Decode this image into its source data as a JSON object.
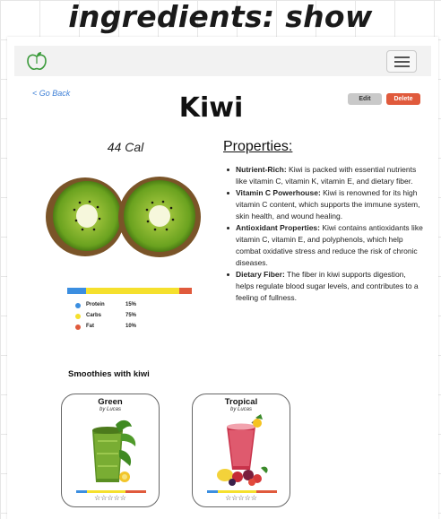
{
  "banner": {
    "text": "ingredients: show"
  },
  "navbar": {
    "logo_icon": "apple-logo-icon",
    "menu_icon": "hamburger-menu-icon"
  },
  "back_link": "< Go Back",
  "ingredient": {
    "name": "Kiwi",
    "calories": "44 Cal",
    "image_icon": "kiwi-halves-image"
  },
  "actions": {
    "edit": "Edit",
    "delete": "Delete"
  },
  "macros": [
    {
      "name": "Protein",
      "percent": "15%",
      "value": 15,
      "color": "#3b8ee0"
    },
    {
      "name": "Carbs",
      "percent": "75%",
      "value": 75,
      "color": "#f5e02d"
    },
    {
      "name": "Fat",
      "percent": "10%",
      "value": 10,
      "color": "#e05a3c"
    }
  ],
  "properties": {
    "title": "Properties:",
    "items": [
      {
        "label": "Nutrient-Rich:",
        "text": " Kiwi is packed with essential nutrients like vitamin C, vitamin K, vitamin E, and dietary fiber."
      },
      {
        "label": "Vitamin C Powerhouse:",
        "text": " Kiwi is renowned for its high vitamin C content, which supports the immune system, skin health, and wound healing."
      },
      {
        "label": "Antioxidant Properties:",
        "text": " Kiwi contains antioxidants like vitamin C, vitamin E, and polyphenols, which help combat oxidative stress and reduce the risk of chronic diseases."
      },
      {
        "label": "Dietary Fiber:",
        "text": " The fiber in kiwi supports digestion, helps regulate blood sugar levels, and contributes to a feeling of fullness."
      }
    ]
  },
  "smoothies": {
    "title": "Smoothies with kiwi",
    "items": [
      {
        "name": "Green",
        "by": "by Lucas",
        "stars": "☆☆☆☆☆",
        "rating": 0,
        "image_icon": "green-smoothie-image"
      },
      {
        "name": "Tropical",
        "by": "by Lucas",
        "stars": "☆☆☆☆☆",
        "rating": 0,
        "image_icon": "tropical-smoothie-image"
      }
    ]
  }
}
